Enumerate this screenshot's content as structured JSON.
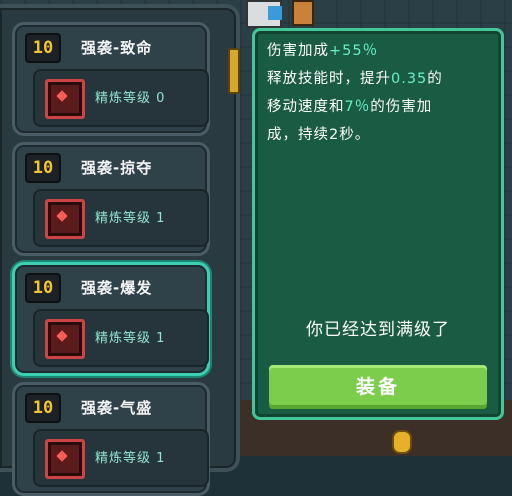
{
  "talents": [
    {
      "level": "10",
      "name": "强袭-致命",
      "refine": "精炼等级 0"
    },
    {
      "level": "10",
      "name": "强袭-掠夺",
      "refine": "精炼等级 1"
    },
    {
      "level": "10",
      "name": "强袭-爆发",
      "refine": "精炼等级 1"
    },
    {
      "level": "10",
      "name": "强袭-气盛",
      "refine": "精炼等级 1"
    }
  ],
  "selected_index": 2,
  "detail": {
    "line1": "伤害加成",
    "line1_value": "+55％",
    "line2_a": "释放技能时，提升",
    "line2_value": "0.35",
    "line2_b": "的",
    "line3_a": "移动速度和",
    "line3_value": "7％",
    "line3_b": "的伤害加",
    "line4": "成，持续2秒。",
    "maxed_text": "你已经达到满级了",
    "equip_label": "装备"
  },
  "colors": {
    "highlight": "#67f0c8",
    "badge_text": "#f2c530",
    "selected_border": "#3ccfb3",
    "equip_button": "#7ccd4c"
  },
  "icons": [
    "skull-talent-icon",
    "swords-talent-icon",
    "burst-talent-icon",
    "aura-talent-icon"
  ]
}
